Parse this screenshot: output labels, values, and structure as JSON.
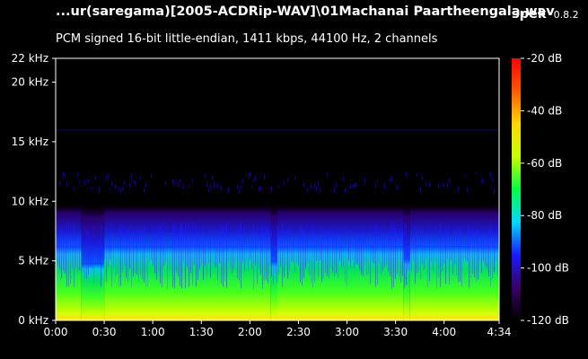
{
  "window": {
    "file_title": "...ur(saregama)[2005-ACDRip-WAV]\\01Machanai Paartheengala.wav",
    "app_name": "spek",
    "app_version": "0.8.2",
    "stream_info": "PCM signed 16-bit little-endian, 1411 kbps, 44100 Hz, 2 channels"
  },
  "chart_data": {
    "type": "heatmap",
    "x_axis": {
      "ticks": [
        "0:00",
        "0:30",
        "1:00",
        "1:30",
        "2:00",
        "2:30",
        "3:00",
        "3:30",
        "4:00",
        "4:34"
      ],
      "tick_seconds": [
        0,
        30,
        60,
        90,
        120,
        150,
        180,
        210,
        240,
        274
      ],
      "range_seconds": [
        0,
        274
      ]
    },
    "y_axis": {
      "ticks": [
        "0 kHz",
        "5 kHz",
        "10 kHz",
        "15 kHz",
        "20 kHz",
        "22 kHz"
      ],
      "tick_khz": [
        0,
        5,
        10,
        15,
        20,
        22
      ],
      "range_khz": [
        0,
        22
      ]
    },
    "color_scale": {
      "ticks": [
        "-20 dB",
        "-40 dB",
        "-60 dB",
        "-80 dB",
        "-100 dB",
        "-120 dB"
      ],
      "tick_db": [
        -20,
        -40,
        -60,
        -80,
        -100,
        -120
      ],
      "range_db": [
        -120,
        -20
      ],
      "colors": [
        "#000000",
        "#3a0066",
        "#1a1aff",
        "#00d8ff",
        "#00ff40",
        "#c8ff00",
        "#ffd800",
        "#ff5a00",
        "#ff0000"
      ]
    },
    "cutoff_khz": 16,
    "series": [
      {
        "segments_seconds": [
          [
            0,
            16
          ],
          [
            16,
            30
          ],
          [
            30,
            133
          ],
          [
            133,
            137
          ],
          [
            137,
            215
          ],
          [
            215,
            219
          ],
          [
            219,
            274
          ]
        ],
        "loud_top_khz": [
          6.2,
          4.8,
          6.2,
          5.0,
          6.2,
          5.2,
          6.2
        ]
      }
    ]
  }
}
